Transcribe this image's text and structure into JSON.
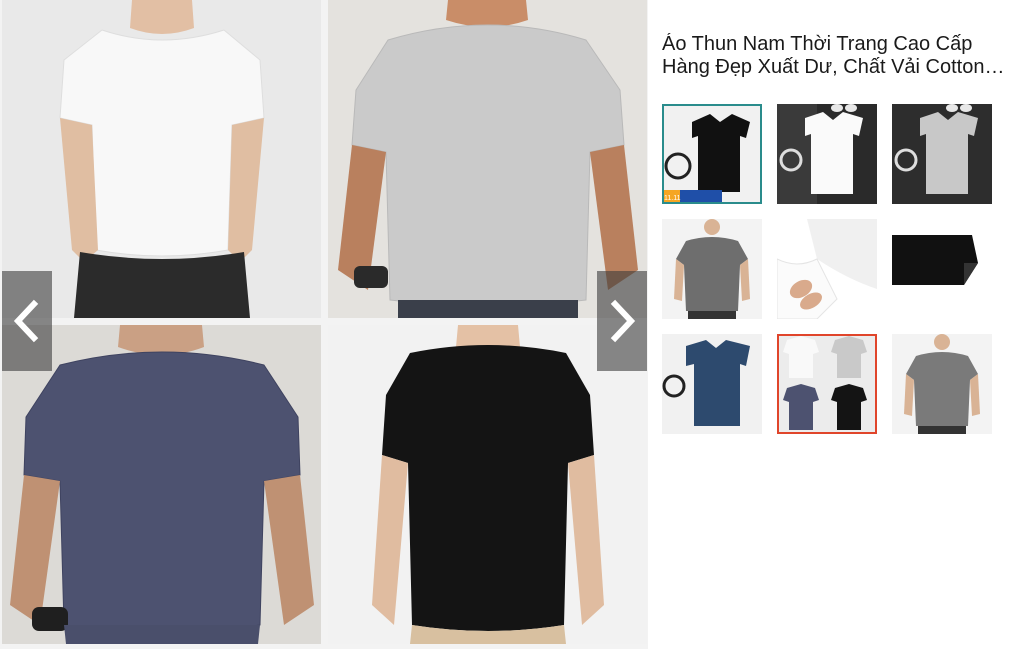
{
  "product": {
    "title": "Áo Thun Nam Thời Trang Cao Cấp Hàng Đẹp Xuất Dư, Chất Vải Cotton Mềm Mịn"
  },
  "viewer": {
    "prev_icon": "chevron-left-icon",
    "next_icon": "chevron-right-icon",
    "tiles": [
      {
        "shirt_color": "#f7f7f7",
        "bg": "#e9e9e9",
        "label": "white-tee"
      },
      {
        "shirt_color": "#c9c9c9",
        "bg": "#e4e2de",
        "label": "grey-tee"
      },
      {
        "shirt_color": "#4d5270",
        "bg": "#dcdad6",
        "label": "navy-tee"
      },
      {
        "shirt_color": "#141414",
        "bg": "#f2f2f2",
        "label": "black-tee"
      }
    ]
  },
  "thumbnails": {
    "selected_index": 0,
    "badge_text": "11.11",
    "items": [
      {
        "kind": "flatlay",
        "color": "#111111"
      },
      {
        "kind": "flatlay",
        "color": "#fafafa"
      },
      {
        "kind": "flatlay",
        "color": "#c8c8c8"
      },
      {
        "kind": "model",
        "color": "#6e6e6e"
      },
      {
        "kind": "fabric",
        "color": "#ffffff"
      },
      {
        "kind": "fabric",
        "color": "#111111"
      },
      {
        "kind": "flatlay",
        "color": "#2d4a6e"
      },
      {
        "kind": "collage",
        "color": "#e0452b"
      },
      {
        "kind": "model",
        "color": "#7a7a7a"
      }
    ]
  },
  "colors": {
    "accent_teal": "#2a8c8c",
    "accent_red": "#e0452b",
    "badge_orange": "#f5a623"
  }
}
